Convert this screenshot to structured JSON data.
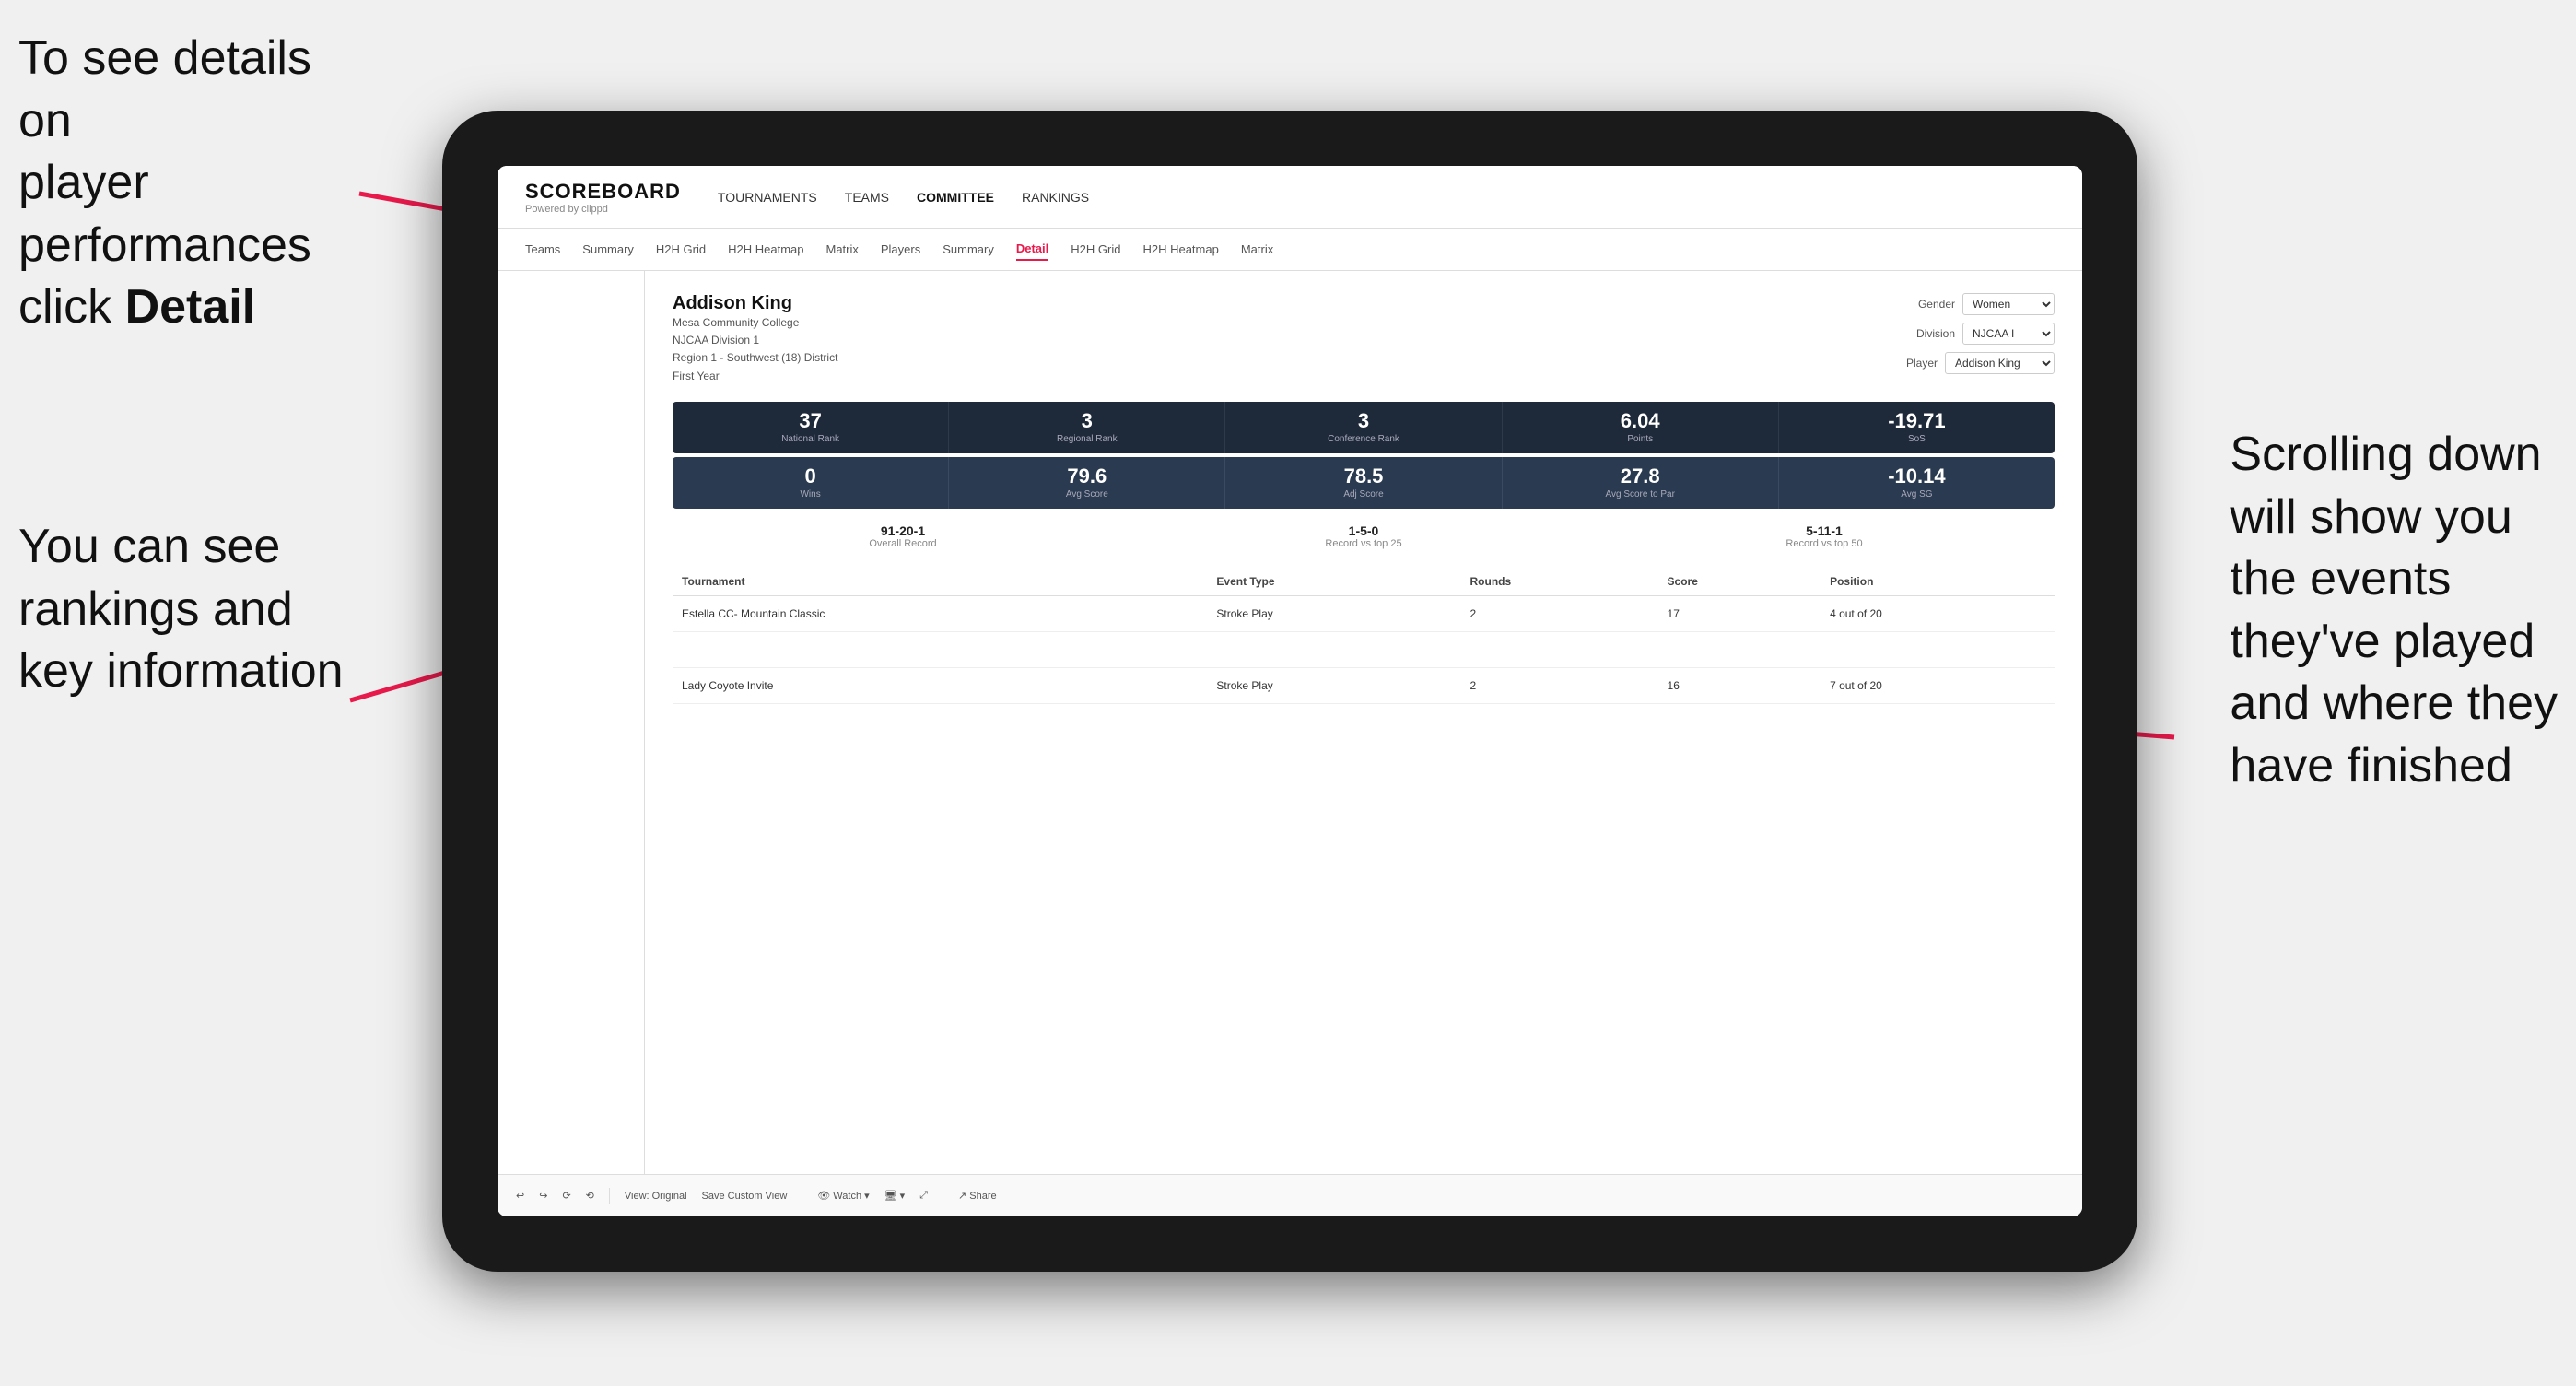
{
  "annotations": {
    "topleft_line1": "To see details on",
    "topleft_line2": "player performances",
    "topleft_line3": "click ",
    "topleft_bold": "Detail",
    "bottomleft_line1": "You can see",
    "bottomleft_line2": "rankings and",
    "bottomleft_line3": "key information",
    "right_line1": "Scrolling down",
    "right_line2": "will show you",
    "right_line3": "the events",
    "right_line4": "they've played",
    "right_line5": "and where they",
    "right_line6": "have finished"
  },
  "app": {
    "logo": {
      "title": "SCOREBOARD",
      "subtitle": "Powered by clippd"
    },
    "topnav": {
      "items": [
        {
          "label": "TOURNAMENTS",
          "active": false
        },
        {
          "label": "TEAMS",
          "active": false
        },
        {
          "label": "COMMITTEE",
          "active": false
        },
        {
          "label": "RANKINGS",
          "active": false
        }
      ]
    },
    "secondarynav": {
      "items": [
        {
          "label": "Teams",
          "active": false
        },
        {
          "label": "Summary",
          "active": false
        },
        {
          "label": "H2H Grid",
          "active": false
        },
        {
          "label": "H2H Heatmap",
          "active": false
        },
        {
          "label": "Matrix",
          "active": false
        },
        {
          "label": "Players",
          "active": false
        },
        {
          "label": "Summary",
          "active": false
        },
        {
          "label": "Detail",
          "active": true
        },
        {
          "label": "H2H Grid",
          "active": false
        },
        {
          "label": "H2H Heatmap",
          "active": false
        },
        {
          "label": "Matrix",
          "active": false
        }
      ]
    },
    "player": {
      "name": "Addison King",
      "college": "Mesa Community College",
      "division": "NJCAA Division 1",
      "region": "Region 1 - Southwest (18) District",
      "year": "First Year",
      "gender_label": "Gender",
      "gender_value": "Women",
      "division_label": "Division",
      "division_value": "NJCAA I",
      "player_label": "Player",
      "player_value": "Addison King"
    },
    "stats_row1": [
      {
        "value": "37",
        "label": "National Rank"
      },
      {
        "value": "3",
        "label": "Regional Rank"
      },
      {
        "value": "3",
        "label": "Conference Rank"
      },
      {
        "value": "6.04",
        "label": "Points"
      },
      {
        "value": "-19.71",
        "label": "SoS"
      }
    ],
    "stats_row2": [
      {
        "value": "0",
        "label": "Wins"
      },
      {
        "value": "79.6",
        "label": "Avg Score"
      },
      {
        "value": "78.5",
        "label": "Adj Score"
      },
      {
        "value": "27.8",
        "label": "Avg Score to Par"
      },
      {
        "value": "-10.14",
        "label": "Avg SG"
      }
    ],
    "records": [
      {
        "value": "91-20-1",
        "label": "Overall Record"
      },
      {
        "value": "1-5-0",
        "label": "Record vs top 25"
      },
      {
        "value": "5-11-1",
        "label": "Record vs top 50"
      }
    ],
    "table": {
      "headers": [
        "Tournament",
        "Event Type",
        "Rounds",
        "Score",
        "Position"
      ],
      "rows": [
        {
          "tournament": "Estella CC- Mountain Classic",
          "event_type": "Stroke Play",
          "rounds": "2",
          "score": "17",
          "position": "4 out of 20"
        },
        {
          "tournament": "",
          "event_type": "",
          "rounds": "",
          "score": "",
          "position": ""
        },
        {
          "tournament": "Lady Coyote Invite",
          "event_type": "Stroke Play",
          "rounds": "2",
          "score": "16",
          "position": "7 out of 20"
        }
      ]
    },
    "toolbar": {
      "items": [
        "↩",
        "↪",
        "⟳",
        "⟲",
        "⊟",
        "⊙",
        "View: Original",
        "Save Custom View",
        "Watch ▾",
        "🖥 ▾",
        "⤢",
        "Share"
      ]
    }
  }
}
